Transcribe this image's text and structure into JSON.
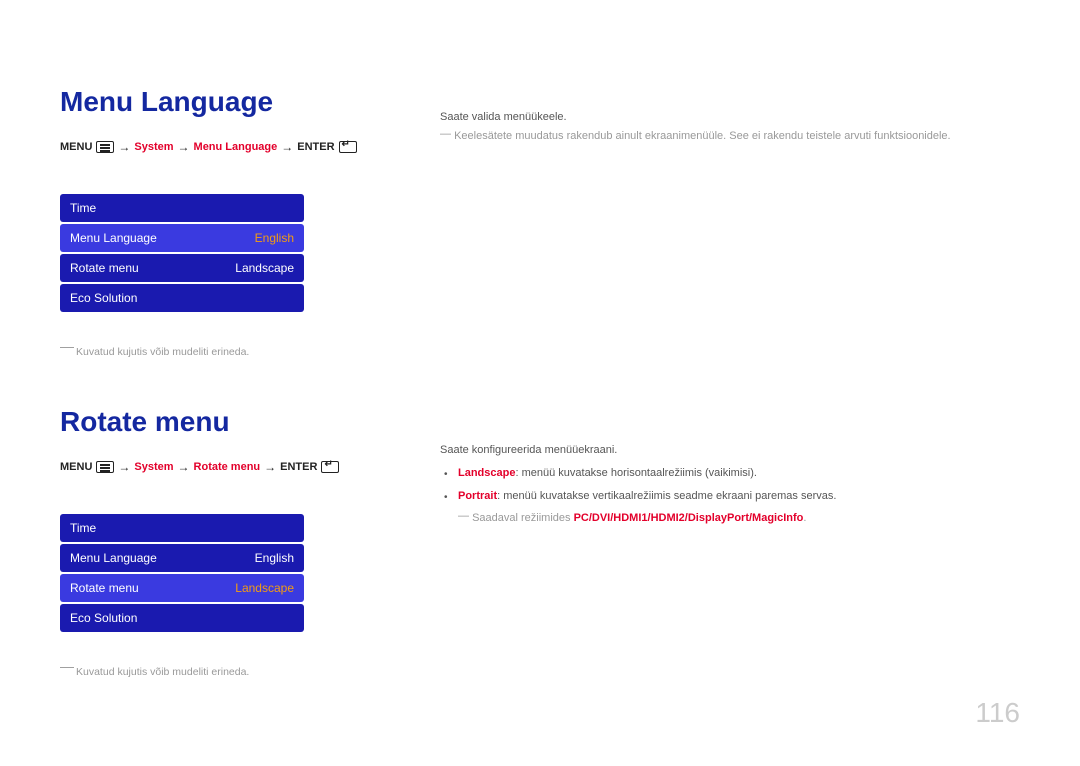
{
  "section1": {
    "title": "Menu Language",
    "path": {
      "menu": "MENU",
      "system": "System",
      "item": "Menu Language",
      "enter": "ENTER"
    },
    "osd": {
      "rows": [
        {
          "label": "Time",
          "value": ""
        },
        {
          "label": "Menu Language",
          "value": "English",
          "selected": true
        },
        {
          "label": "Rotate menu",
          "value": "Landscape"
        },
        {
          "label": "Eco Solution",
          "value": ""
        }
      ]
    },
    "footnote": "Kuvatud kujutis võib mudeliti erineda.",
    "right": {
      "line1": "Saate valida menüükeele.",
      "line2": "Keelesätete muudatus rakendub ainult ekraanimenüüle. See ei rakendu teistele arvuti funktsioonidele."
    }
  },
  "section2": {
    "title": "Rotate menu",
    "path": {
      "menu": "MENU",
      "system": "System",
      "item": "Rotate menu",
      "enter": "ENTER"
    },
    "osd": {
      "rows": [
        {
          "label": "Time",
          "value": ""
        },
        {
          "label": "Menu Language",
          "value": "English"
        },
        {
          "label": "Rotate menu",
          "value": "Landscape",
          "selected": true
        },
        {
          "label": "Eco Solution",
          "value": ""
        }
      ]
    },
    "footnote": "Kuvatud kujutis võib mudeliti erineda.",
    "right": {
      "line1": "Saate konfigureerida menüüekraani.",
      "bullets": [
        {
          "bold": "Landscape",
          "rest": ": menüü kuvatakse horisontaalrežiimis (vaikimisi)."
        },
        {
          "bold": "Portrait",
          "rest": ": menüü kuvatakse vertikaalrežiimis seadme ekraani paremas servas."
        }
      ],
      "note_pre": "Saadaval režiimides ",
      "note_modes": "PC/DVI/HDMI1/HDMI2/DisplayPort/MagicInfo",
      "note_post": "."
    }
  },
  "page_number": "116"
}
